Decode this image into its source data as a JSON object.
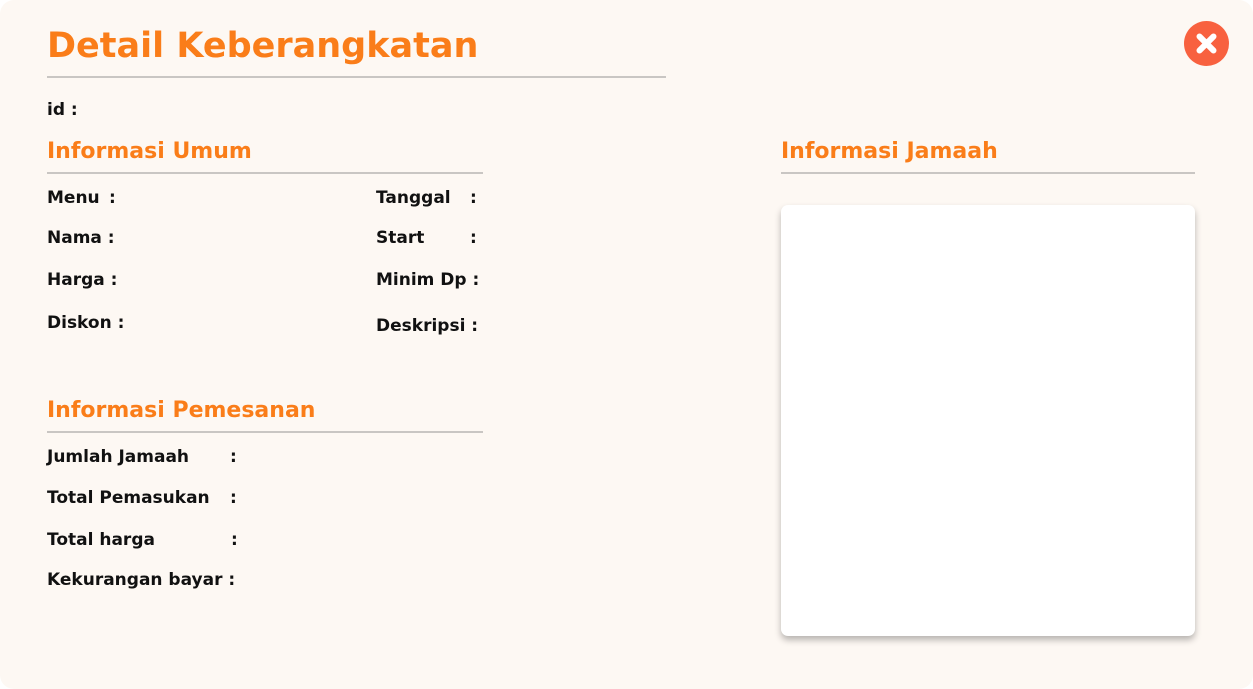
{
  "modal": {
    "title": "Detail Keberangkatan",
    "close_icon": "close-x-icon",
    "id_label": "id :"
  },
  "umum": {
    "title": "Informasi Umum",
    "menu": "Menu",
    "tanggal": "Tanggal",
    "nama": "Nama :",
    "start": "Start",
    "harga": "Harga :",
    "minim_dp": "Minim Dp :",
    "diskon": "Diskon :",
    "deskripsi": "Deskripsi :",
    "colon": ":"
  },
  "pemesanan": {
    "title": "Informasi Pemesanan",
    "jumlah_jamaah": "Jumlah Jamaah",
    "total_pemasukan": "Total Pemasukan",
    "total_harga": "Total harga",
    "kekurangan_bayar": "Kekurangan bayar :",
    "colon": ":"
  },
  "jamaah": {
    "title": "Informasi Jamaah"
  },
  "colors": {
    "accent": "#fa7d19",
    "close": "#f8613f",
    "background": "#fdf8f3"
  }
}
